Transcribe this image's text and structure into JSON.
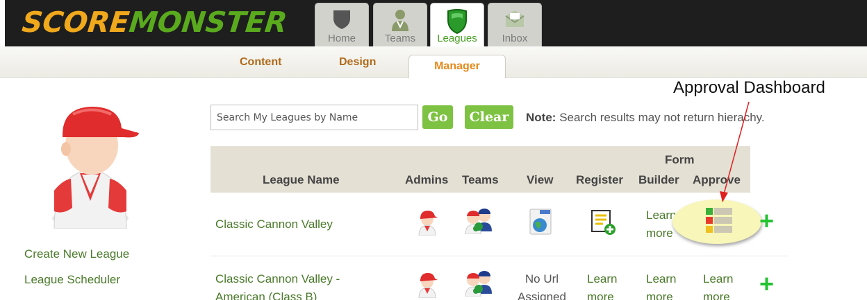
{
  "app": {
    "logo_part1": "SCORE",
    "logo_part2": "MONSTER"
  },
  "top_tabs": [
    {
      "label": "Home",
      "icon": "shield-icon"
    },
    {
      "label": "Teams",
      "icon": "player-icon"
    },
    {
      "label": "Leagues",
      "icon": "green-shield-icon",
      "active": true
    },
    {
      "label": "Inbox",
      "icon": "envelope-icon"
    }
  ],
  "sub_tabs": [
    {
      "label": "Content"
    },
    {
      "label": "Design"
    },
    {
      "label": "Manager",
      "active": true
    }
  ],
  "annotation": {
    "label": "Approval Dashboard"
  },
  "sidebar": {
    "links": [
      {
        "label": "Create New League"
      },
      {
        "label": "League Scheduler"
      }
    ]
  },
  "search": {
    "placeholder": "Search My Leagues by Name",
    "go_label": "Go",
    "clear_label": "Clear",
    "note_label": "Note:",
    "note_text": "Search results may not return hierachy."
  },
  "table": {
    "headers": {
      "league_name": "League Name",
      "admins": "Admins",
      "teams": "Teams",
      "view": "View",
      "register": "Register",
      "form_builder_1": "Form",
      "form_builder_2": "Builder",
      "approve": "Approve"
    },
    "rows": [
      {
        "name": "Classic Cannon Valley",
        "form_builder_1": "Learn",
        "form_builder_2": "more",
        "add": "+"
      },
      {
        "name_1": "Classic Cannon Valley -",
        "name_2": "American (Class B)",
        "view_1": "No Url",
        "view_2": "Assigned",
        "register_1": "Learn",
        "register_2": "more",
        "form_builder_1": "Learn",
        "form_builder_2": "more",
        "approve_1": "Learn",
        "approve_2": "more",
        "add": "+"
      }
    ]
  },
  "colors": {
    "brand_orange": "#f0a81c",
    "brand_green": "#5aaa1e",
    "link_green": "#4a7a2a",
    "button_green": "#7dc242",
    "header_bg": "#e4e0d4",
    "tab_active_orange": "#e48a1c",
    "arrow_red": "#e02020"
  }
}
